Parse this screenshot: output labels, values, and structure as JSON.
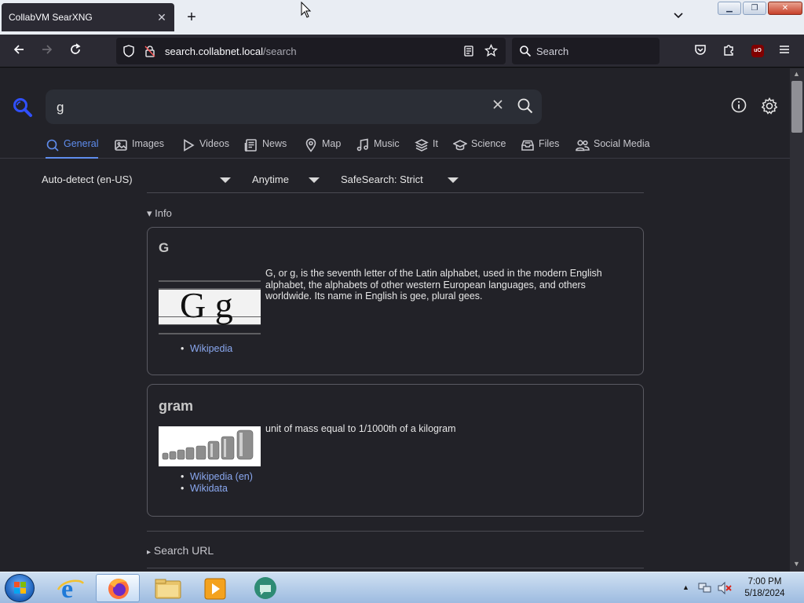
{
  "browser": {
    "tab_title": "CollabVM SearXNG",
    "tab_close": "✕",
    "new_tab": "+",
    "url_host": "search.collabnet.local",
    "url_path": "/search",
    "search_placeholder": "Search"
  },
  "search": {
    "query": "g"
  },
  "categories": [
    {
      "label": "General",
      "icon": "search-icon",
      "active": true
    },
    {
      "label": "Images",
      "icon": "image-icon",
      "active": false
    },
    {
      "label": "Videos",
      "icon": "play-icon",
      "active": false
    },
    {
      "label": "News",
      "icon": "newspaper-icon",
      "active": false
    },
    {
      "label": "Map",
      "icon": "map-pin-icon",
      "active": false
    },
    {
      "label": "Music",
      "icon": "music-note-icon",
      "active": false
    },
    {
      "label": "It",
      "icon": "layers-icon",
      "active": false
    },
    {
      "label": "Science",
      "icon": "school-icon",
      "active": false
    },
    {
      "label": "Files",
      "icon": "file-tray-icon",
      "active": false
    },
    {
      "label": "Social Media",
      "icon": "people-icon",
      "active": false
    }
  ],
  "filters": {
    "language": "Auto-detect (en-US)",
    "time_range": "Anytime",
    "safesearch": "SafeSearch: Strict"
  },
  "info_section": {
    "toggle": "▾",
    "label": "Info"
  },
  "infoboxes": [
    {
      "title": "G",
      "image_text": "G g",
      "description": "G, or g, is the seventh letter of the Latin alphabet, used in the modern English alphabet, the alphabets of other western European languages, and others worldwide. Its name in English is gee, plural gees.",
      "links": [
        "Wikipedia"
      ]
    },
    {
      "title": "gram",
      "description": "unit of mass equal to 1/1000th of a kilogram",
      "links": [
        "Wikipedia (en)",
        "Wikidata"
      ]
    }
  ],
  "search_url_section": {
    "toggle": "▸",
    "label": "Search URL"
  },
  "taskbar": {
    "time": "7:00 PM",
    "date": "5/18/2024"
  },
  "colors": {
    "accent": "#5f8dee",
    "link": "#8aa8f0",
    "page_bg": "#222228"
  }
}
